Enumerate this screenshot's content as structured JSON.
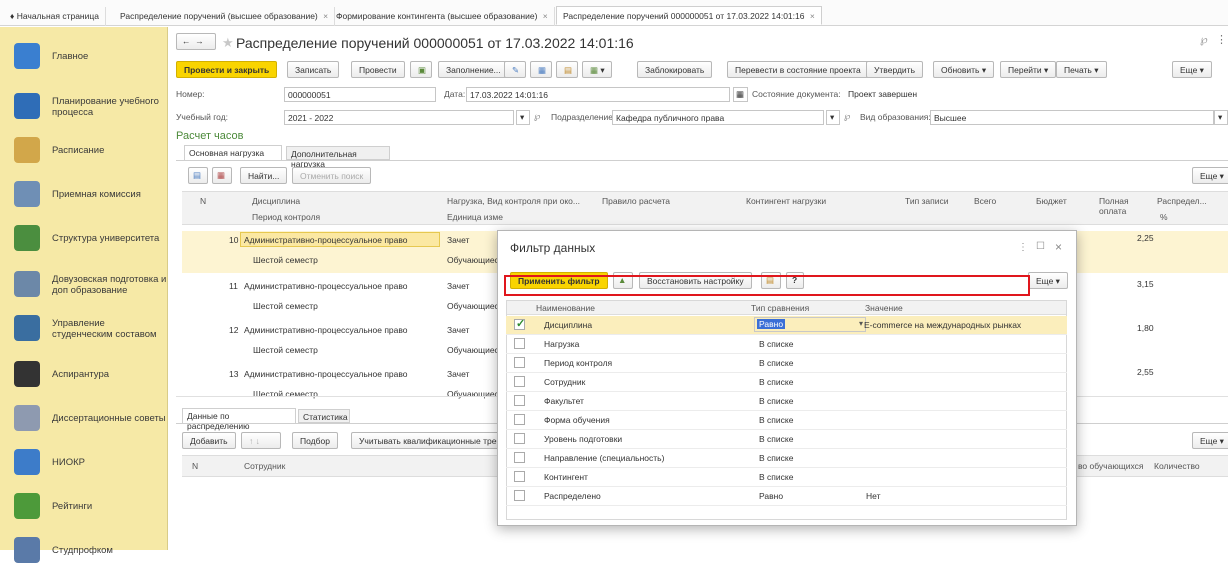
{
  "tabs": [
    {
      "label": "Начальная страница",
      "home": true
    },
    {
      "label": "Распределение поручений (высшее образование)"
    },
    {
      "label": "Формирование контингента (высшее образование)"
    },
    {
      "label": "Распределение поручений 000000051 от 17.03.2022 14:01:16"
    }
  ],
  "sidebar": [
    {
      "label": "Главное",
      "color": "#3a7fd0"
    },
    {
      "label": "Планирование учебного процесса",
      "color": "#2f6db7"
    },
    {
      "label": "Расписание",
      "color": "#d2a74a"
    },
    {
      "label": "Приемная комиссия",
      "color": "#6f8fb5"
    },
    {
      "label": "Структура университета",
      "color": "#4b8e3f"
    },
    {
      "label": "Довузовская подготовка и доп образование",
      "color": "#6c88a8"
    },
    {
      "label": "Управление студенческим составом",
      "color": "#3a6ea0"
    },
    {
      "label": "Аспирантура",
      "color": "#333333"
    },
    {
      "label": "Диссертационные советы",
      "color": "#8e9ab0"
    },
    {
      "label": "НИОКР",
      "color": "#3d7cc9"
    },
    {
      "label": "Рейтинги",
      "color": "#4d9a3a"
    },
    {
      "label": "Студпрофком",
      "color": "#5a7aa8"
    }
  ],
  "doc": {
    "title": "Распределение поручений 000000051 от 17.03.2022 14:01:16",
    "buttons": {
      "post_close": "Провести и закрыть",
      "save": "Записать",
      "post": "Провести",
      "fill": "Заполнение...",
      "block": "Заблокировать",
      "to_project": "Перевести в состояние проекта",
      "approve": "Утвердить",
      "refresh": "Обновить",
      "goto": "Перейти",
      "print": "Печать",
      "more": "Еще"
    },
    "number_label": "Номер:",
    "number": "000000051",
    "date_label": "Дата:",
    "date": "17.03.2022 14:01:16",
    "state_label": "Состояние документа:",
    "state": "Проект завершен",
    "year_label": "Учебный год:",
    "year": "2021 - 2022",
    "division_label": "Подразделение:",
    "division": "Кафедра публичного права",
    "edu_label": "Вид образования:",
    "edu": "Высшее",
    "section": "Расчет часов"
  },
  "upper": {
    "tabs": [
      "Основная нагрузка",
      "Дополнительная нагрузка"
    ],
    "find": "Найти...",
    "cancel_search": "Отменить поиск",
    "more": "Еще",
    "headers": {
      "n": "N",
      "discipline": "Дисциплина",
      "control_period": "Период контроля",
      "load": "Нагрузка, Вид контроля при око...",
      "unit": "Единица изме",
      "rule": "Правило расчета",
      "contingent": "Контингент нагрузки",
      "record_type": "Тип записи",
      "total": "Всего",
      "budget": "Бюджет",
      "full_pay": "Полная оплата",
      "distrib": "Распредел...",
      "percent": "%"
    },
    "rows": [
      {
        "n": "10",
        "discipline": "Административно-процессуальное право",
        "period": "Шестой семестр",
        "load": "Зачет",
        "unit": "Обучающиеся",
        "full": "2,25"
      },
      {
        "n": "11",
        "discipline": "Административно-процессуальное право",
        "period": "Шестой семестр",
        "load": "Зачет",
        "unit": "Обучающиес",
        "full": "3,15"
      },
      {
        "n": "12",
        "discipline": "Административно-процессуальное право",
        "period": "Шестой семестр",
        "load": "Зачет",
        "unit": "Обучающиес",
        "full": "1,80"
      },
      {
        "n": "13",
        "discipline": "Административно-процессуальное право",
        "period": "Шестой семестр",
        "load": "Зачет",
        "unit": "Обучающиес",
        "full": "2,55"
      }
    ]
  },
  "lower": {
    "tabs": [
      "Данные по распределению",
      "Статистика"
    ],
    "add": "Добавить",
    "pick": "Подбор",
    "qualif": "Учитывать квалификационные треб",
    "more": "Еще",
    "headers": {
      "n": "N",
      "employee": "Сотрудник",
      "students": "во обучающихся",
      "count": "Количество"
    }
  },
  "dialog": {
    "title": "Фильтр данных",
    "apply": "Применить фильтр",
    "restore": "Восстановить настройку",
    "help": "?",
    "more": "Еще",
    "headers": {
      "name": "Наименование",
      "compare": "Тип сравнения",
      "value": "Значение"
    },
    "rows": [
      {
        "name": "Дисциплина",
        "compare": "Равно",
        "value": "E-commerce на международных рынках",
        "checked": true
      },
      {
        "name": "Нагрузка",
        "compare": "В списке",
        "value": ""
      },
      {
        "name": "Период контроля",
        "compare": "В списке",
        "value": ""
      },
      {
        "name": "Сотрудник",
        "compare": "В списке",
        "value": ""
      },
      {
        "name": "Факультет",
        "compare": "В списке",
        "value": ""
      },
      {
        "name": "Форма обучения",
        "compare": "В списке",
        "value": ""
      },
      {
        "name": "Уровень подготовки",
        "compare": "В списке",
        "value": ""
      },
      {
        "name": "Направление (специальность)",
        "compare": "В списке",
        "value": ""
      },
      {
        "name": "Контингент",
        "compare": "В списке",
        "value": ""
      },
      {
        "name": "Распределено",
        "compare": "Равно",
        "value": "Нет"
      }
    ]
  },
  "colors": {
    "accent": "#f9d400",
    "selection_border": "#e0161d",
    "sidebar": "#f6e9a6"
  }
}
